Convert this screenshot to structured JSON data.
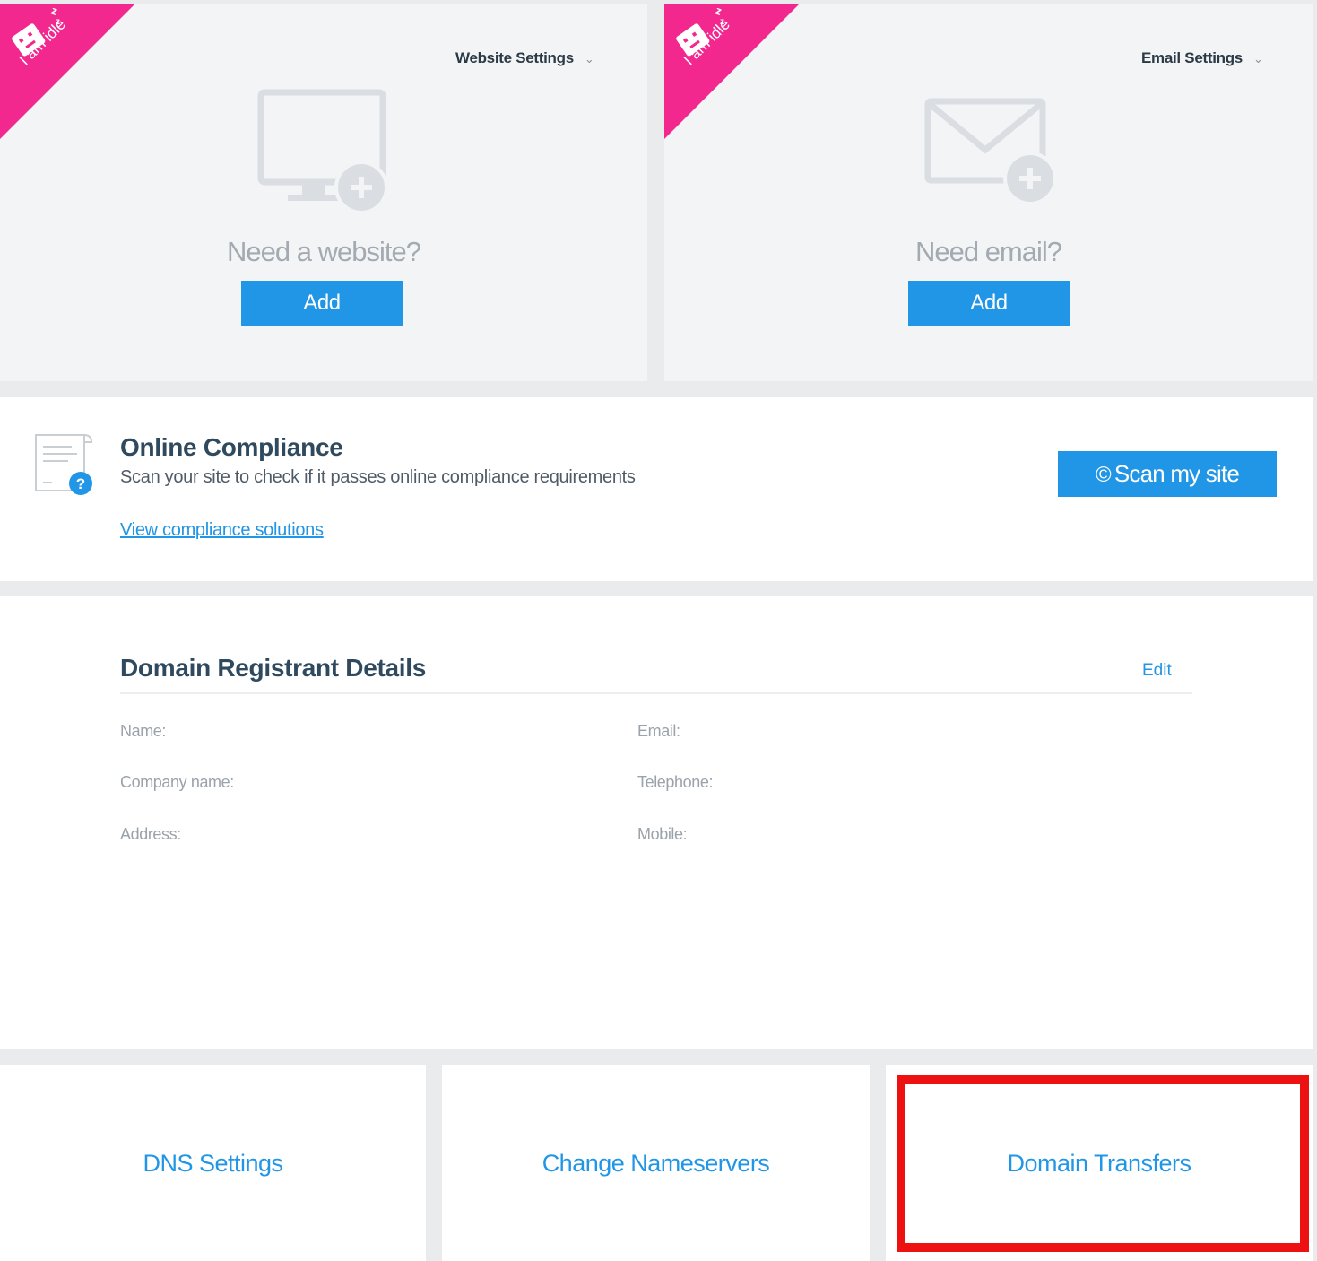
{
  "website_card": {
    "ribbon_text": "I am idle",
    "settings_label": "Website Settings",
    "prompt": "Need a website?",
    "add_label": "Add"
  },
  "email_card": {
    "ribbon_text": "I am idle",
    "settings_label": "Email Settings",
    "prompt": "Need email?",
    "add_label": "Add"
  },
  "compliance": {
    "title": "Online Compliance",
    "subtitle": "Scan your site to check if it passes online compliance requirements",
    "link_label": "View compliance solutions",
    "scan_label": "Scan my site"
  },
  "registrant": {
    "title": "Domain Registrant Details",
    "edit_label": "Edit",
    "fields": {
      "name": "Name:",
      "company": "Company name:",
      "address": "Address:",
      "email": "Email:",
      "telephone": "Telephone:",
      "mobile": "Mobile:"
    }
  },
  "tiles": {
    "dns": "DNS Settings",
    "nameservers": "Change Nameservers",
    "transfers": "Domain Transfers"
  },
  "colors": {
    "accent": "#2196e6",
    "ribbon": "#f2288f",
    "highlight": "#ee1111",
    "card_bg": "#f3f4f6"
  },
  "icons": {
    "ribbon_mascot": "idle-ghost-icon",
    "website": "monitor-add-icon",
    "email": "envelope-add-icon",
    "compliance": "document-question-icon",
    "scan": "copyright-circle-icon"
  }
}
